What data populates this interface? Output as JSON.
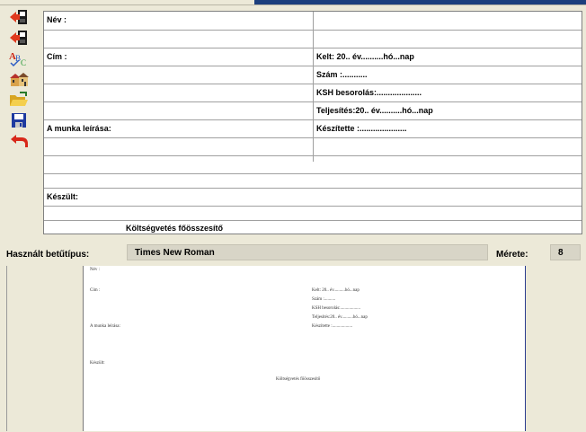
{
  "toolbar": {
    "buttons": [
      {
        "name": "export-icon"
      },
      {
        "name": "import-icon"
      },
      {
        "name": "spellcheck-icon"
      },
      {
        "name": "buildings-icon"
      },
      {
        "name": "open-folder-icon"
      },
      {
        "name": "save-icon"
      },
      {
        "name": "undo-icon"
      }
    ]
  },
  "form": {
    "nev_label": "Név :",
    "cim_label": "Cím :",
    "kelt": "Kelt:    20.. év..........hó...nap",
    "szam": "Szám      :...........",
    "ksh": "KSH besorolás:....................",
    "teljesites": "Teljesítés:20..  év..........hó...nap",
    "munka_label": "A munka leírása:",
    "keszitette": "Készítette   :.....................",
    "keszult_label": "Készült:",
    "footer_title": "Költségvetés főösszesítő"
  },
  "fontbar": {
    "label": "Használt betűtípus:",
    "font_value": "Times New Roman",
    "size_label": "Mérete:",
    "size_value": "8"
  },
  "preview": {
    "nev": "Név :",
    "cim": "Cím :",
    "kelt": "Kelt:   20.. év..........hó...nap",
    "szam": "Szám       :..........",
    "ksh": "KSH besorolás:..................",
    "teljesites": "Teljesítés:20.. év..........hó...nap",
    "munka": "A munka leírása:",
    "keszitette": "Készítette   :..................",
    "keszult": "Készült:",
    "title": "Költségvetés főösszesítő"
  }
}
